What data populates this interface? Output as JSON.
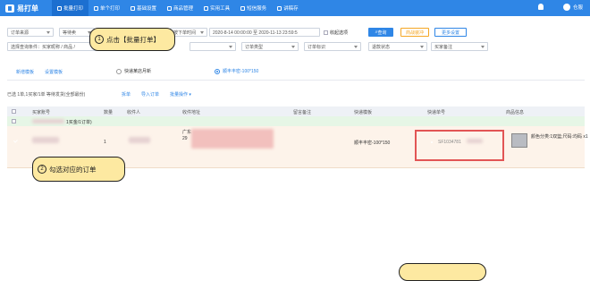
{
  "app": {
    "name": "易打单"
  },
  "nav": [
    {
      "label": "批量打印",
      "icon": "printer-icon"
    },
    {
      "label": "单个打印",
      "icon": "printer-icon"
    },
    {
      "label": "基础设置",
      "icon": "gear-icon"
    },
    {
      "label": "商品管理",
      "icon": "box-icon"
    },
    {
      "label": "实用工具",
      "icon": "tool-icon"
    },
    {
      "label": "短信服务",
      "icon": "message-icon"
    },
    {
      "label": "讲稿存",
      "icon": "document-icon"
    }
  ],
  "user": {
    "name": "仓服"
  },
  "filters": {
    "row1": {
      "order_source": "订单来源",
      "status": "等待卖",
      "time_type": "按下单时间",
      "date_range": "2020-8-14 00:00:00 至 2020-11-13 23:59:5",
      "collapse_label": "收起选项",
      "search_btn": "查询",
      "batch_label": "商战装冲",
      "more_settings": "更多设置"
    },
    "row2": {
      "select_condition": "选择查询条件：买家昵称 / 商品 /",
      "shop_placeholder": "",
      "order_type": "订单类型",
      "order_flag": "订单标识",
      "refund_status": "退款状态",
      "buyer_note": "买家备注"
    }
  },
  "template_tabs": {
    "new_template": "新增模板",
    "set_template": "设置模板",
    "option_a": "快递某店月新",
    "option_b": "顺丰丰密-100*150"
  },
  "summary": {
    "text": "已选 1单,1买家/1单   等待发货(全部最份)",
    "actions": [
      "拆单",
      "导入订单",
      "批量操作"
    ]
  },
  "table": {
    "headers": [
      "买家账号",
      "数量",
      "收件人",
      "收件地址",
      "留言备注",
      "快递模板",
      "快递单号",
      "商品信息"
    ],
    "group_label": "1买金/1订单)",
    "row": {
      "quantity": "1",
      "address": "广东 29",
      "template": "顺丰丰密-100*150",
      "tracking": "SF1034781",
      "goods": "颜色分类:1双篮;尺码:均码 x1"
    }
  },
  "annotations": {
    "step1": {
      "num": "①",
      "text": "点击【批量打单】"
    },
    "step2": {
      "num": "②",
      "text": "勾选对应的订单"
    }
  },
  "colors": {
    "primary": "#2f86e6",
    "highlight_row": "#fdf3ea",
    "annotation": "#fde9a1",
    "error": "#e25555"
  }
}
